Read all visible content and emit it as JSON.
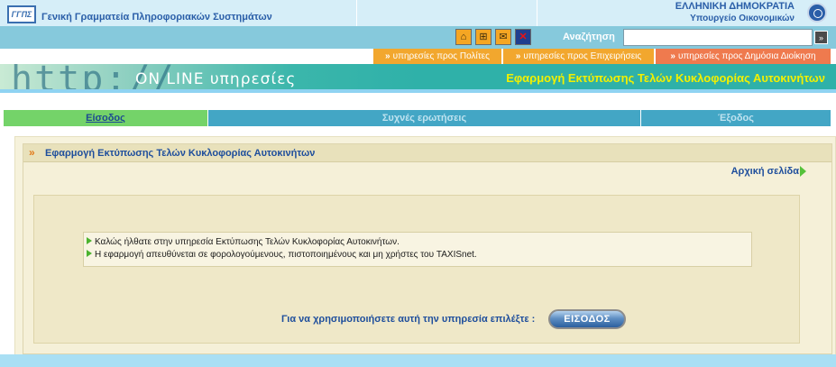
{
  "header": {
    "logo_text": "ΓΓΠΣ",
    "org_name": "Γενική Γραμματεία Πληροφοριακών Συστημάτων",
    "gov_line1": "ΕΛΛΗΝΙΚΗ ΔΗΜΟΚΡΑΤΙΑ",
    "gov_line2": "Υπουργείο Οικονομικών",
    "emblem_icon": "hellenic-republic-emblem-icon"
  },
  "toolbar": {
    "icons": [
      "home-icon",
      "sitemap-icon",
      "contact-icon",
      "english-flag-icon"
    ],
    "icon_glyphs": [
      "⌂",
      "⊞",
      "✉",
      "✕"
    ],
    "search_label": "Αναζήτηση",
    "search_value": "",
    "search_button": "»"
  },
  "audience_tabs": [
    {
      "label": "υπηρεσίες προς Πολίτες",
      "color": "#f2a72e"
    },
    {
      "label": "υπηρεσίες προς Επιχειρήσεις",
      "color": "#f2a72e"
    },
    {
      "label": "υπηρεσίες προς Δημόσια Διοίκηση",
      "color": "#ef7a4e"
    }
  ],
  "banner": {
    "http_text": "http://",
    "online_text": "ON LINE υπηρεσίες",
    "title": "Εφαρμογή Εκτύπωσης Τελών Κυκλοφορίας Αυτοκινήτων",
    "title_color": "#f3f000"
  },
  "nav": {
    "login": "Είσοδος",
    "faq": "Συχνές ερωτήσεις",
    "logout": "Έξοδος",
    "active_color": "#74d369",
    "inactive_color": "#43a6c5"
  },
  "panel": {
    "title": "Εφαρμογή Εκτύπωσης Τελών Κυκλοφορίας Αυτοκινήτων",
    "home_link": "Αρχική σελίδα",
    "messages": [
      "Καλώς ήλθατε στην υπηρεσία Εκτύπωσης Τελών Κυκλοφορίας Αυτοκινήτων.",
      "Η εφαρμογή απευθύνεται σε φορολογούμενους, πιστοποιημένους και μη χρήστες του TAXISnet."
    ],
    "prompt": "Για να χρησιμοποιήσετε αυτή την υπηρεσία επιλέξτε :",
    "enter_button": "ΕΙΣΟΔΟΣ"
  }
}
